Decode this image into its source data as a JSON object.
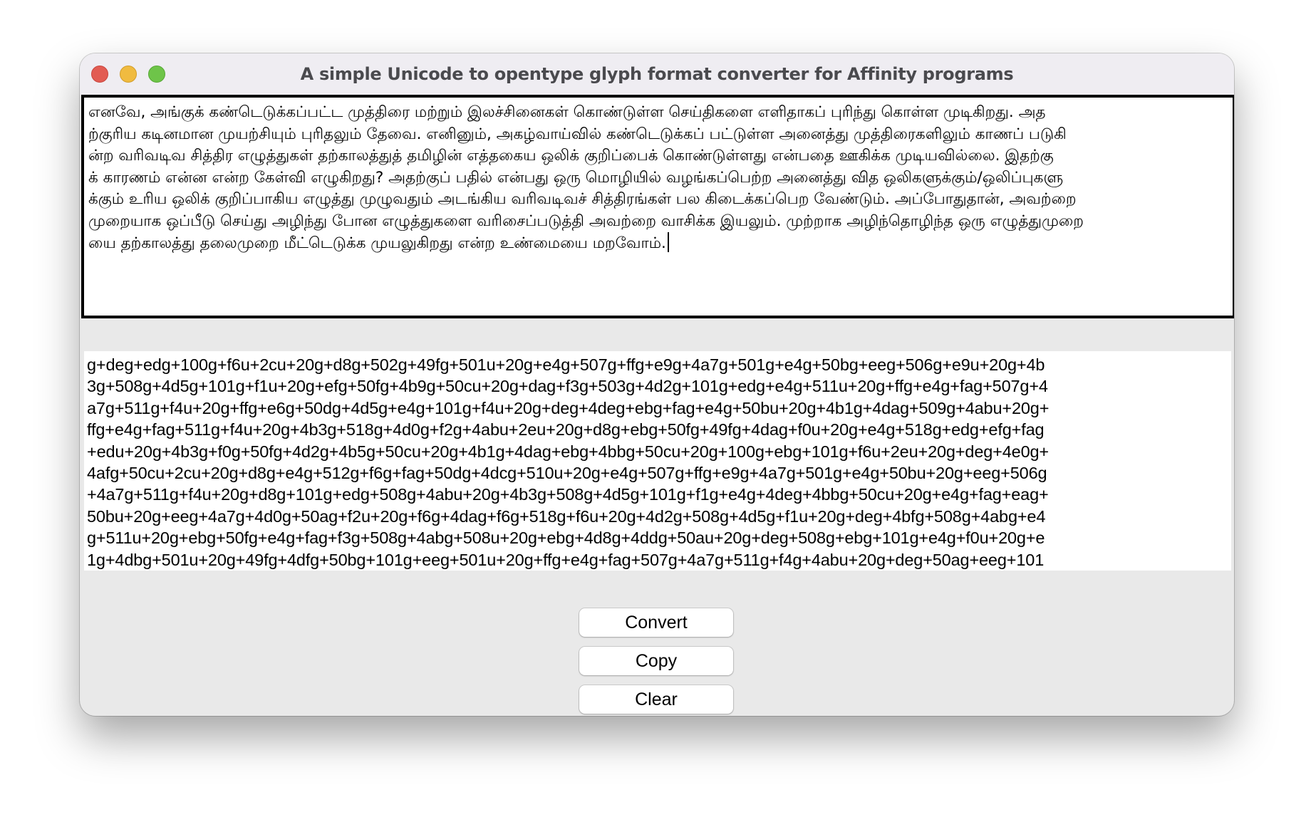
{
  "window": {
    "title": "A simple Unicode to opentype glyph format converter for Affinity programs",
    "controls": [
      "close",
      "minimize",
      "maximize"
    ]
  },
  "input": {
    "lines": [
      "எனவே, அங்குக் கண்டெடுக்கப்பட்ட முத்திரை மற்றும் இலச்சினைகள் கொண்டுள்ள செய்திகளை எளிதாகப் புரிந்து கொள்ள முடிகிறது. அத",
      "ற்குரிய கடினமான முயற்சியும் புரிதலும் தேவை. எனினும், அகழ்வாய்வில் கண்டெடுக்கப் பட்டுள்ள அனைத்து முத்திரைகளிலும் காணப் படுகி",
      "ன்ற வரிவடிவ சித்திர எழுத்துகள் தற்காலத்துத் தமிழின் எத்தகைய ஒலிக் குறிப்பைக் கொண்டுள்ளது என்பதை ஊகிக்க முடியவில்லை. இதற்கு",
      "க் காரணம் என்ன என்ற கேள்வி எழுகிறது? அதற்குப் பதில் என்பது ஒரு மொழியில் வழங்கப்பெற்ற அனைத்து வித ஒலிகளுக்கும்/ஒலிப்புகளு",
      "க்கும் உரிய ஒலிக் குறிப்பாகிய எழுத்து முழுவதும் அடங்கிய வரிவடிவச் சித்திரங்கள் பல கிடைக்கப்பெற வேண்டும். அப்போதுதான், அவற்றை",
      "முறையாக ஒப்பீடு செய்து அழிந்து போன எழுத்துகளை வரிசைப்படுத்தி அவற்றை வாசிக்க இயலும். முற்றாக அழிந்தொழிந்த ஒரு எழுத்துமுறை",
      "யை தற்காலத்து தலைமுறை மீட்டெடுக்க முயலுகிறது என்ற உண்மையை மறவோம்."
    ]
  },
  "output": {
    "lines": [
      "g+deg+edg+100g+f6u+2cu+20g+d8g+502g+49fg+501u+20g+e4g+507g+ffg+e9g+4a7g+501g+e4g+50bg+eeg+506g+e9u+20g+4b",
      "3g+508g+4d5g+101g+f1u+20g+efg+50fg+4b9g+50cu+20g+dag+f3g+503g+4d2g+101g+edg+e4g+511u+20g+ffg+e4g+fag+507g+4",
      "a7g+511g+f4u+20g+ffg+e6g+50dg+4d5g+e4g+101g+f4u+20g+deg+4deg+ebg+fag+e4g+50bu+20g+4b1g+4dag+509g+4abu+20g+",
      "ffg+e4g+fag+511g+f4u+20g+4b3g+518g+4d0g+f2g+4abu+2eu+20g+d8g+ebg+50fg+49fg+4dag+f0u+20g+e4g+518g+edg+efg+fag",
      "+edu+20g+4b3g+f0g+50fg+4d2g+4b5g+50cu+20g+4b1g+4dag+ebg+4bbg+50cu+20g+100g+ebg+101g+f6u+2eu+20g+deg+4e0g+",
      "4afg+50cu+2cu+20g+d8g+e4g+512g+f6g+fag+50dg+4dcg+510u+20g+e4g+507g+ffg+e9g+4a7g+501g+e4g+50bu+20g+eeg+506g",
      "+4a7g+511g+f4u+20g+d8g+101g+edg+508g+4abu+20g+4b3g+508g+4d5g+101g+f1g+e4g+4deg+4bbg+50cu+20g+e4g+fag+eag+",
      "50bu+20g+eeg+4a7g+4d0g+50ag+f2u+20g+f6g+4dag+f6g+518g+f6u+20g+4d2g+508g+4d5g+f1u+20g+deg+4bfg+508g+4abg+e4",
      "g+511u+20g+ebg+50fg+e4g+fag+f3g+508g+4abg+508u+20g+ebg+4d8g+4ddg+50au+20g+deg+508g+ebg+101g+e4g+f0u+20g+e",
      "1g+4dbg+501u+20g+49fg+4dfg+50bg+101g+eeg+501u+20g+ffg+e4g+fag+507g+4a7g+511g+f4g+4abu+20g+deg+50ag+eeg+101"
    ]
  },
  "buttons": {
    "convert": "Convert",
    "copy": "Copy",
    "clear": "Clear"
  }
}
